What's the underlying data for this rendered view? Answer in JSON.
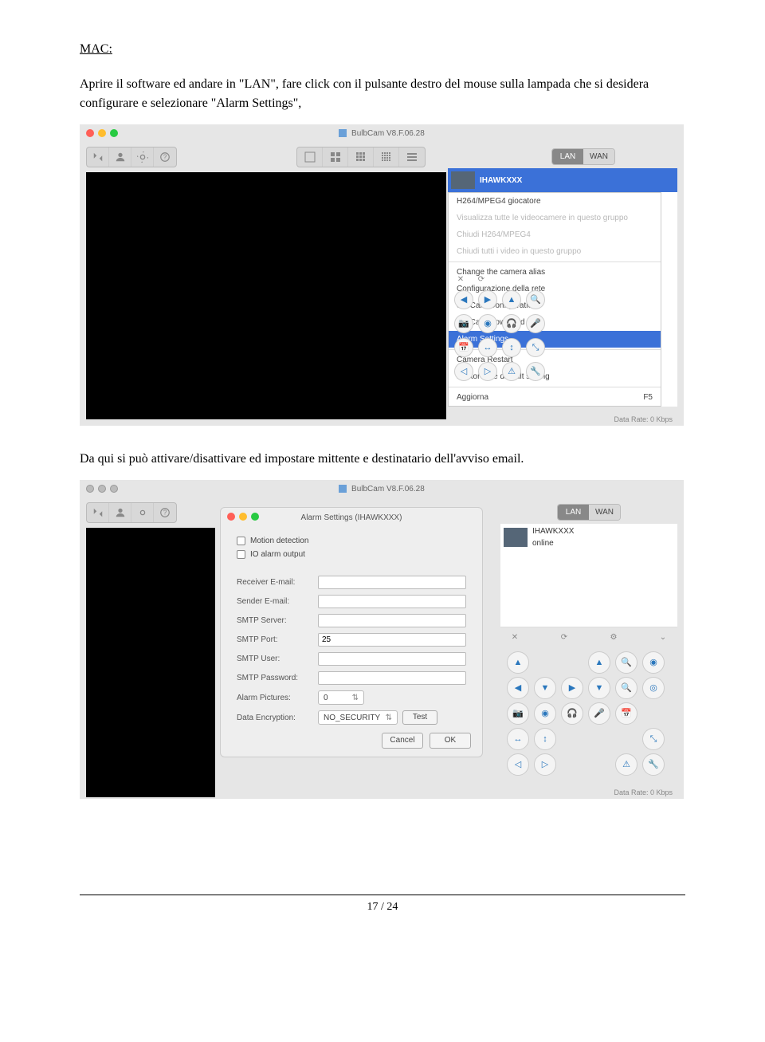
{
  "doc": {
    "heading": "MAC:",
    "para1": "Aprire il software ed andare in \"LAN\", fare click con il pulsante destro del mouse sulla lampada che si desidera configurare e selezionare \"Alarm Settings\",",
    "para2": "Da qui si può attivare/disattivare ed impostare mittente e destinatario dell'avviso email.",
    "page": "17 / 24"
  },
  "app": {
    "title": "BulbCam V8.F.06.28"
  },
  "tabs": {
    "lan": "LAN",
    "wan": "WAN"
  },
  "camera": {
    "name1": "IHAWKXXX",
    "status": "online"
  },
  "menu": {
    "0": "H264/MPEG4 giocatore",
    "1": "Visualizza tutte le videocamere in questo gruppo",
    "2": "Chiudi H264/MPEG4",
    "3": "Chiudi tutti i video in questo gruppo",
    "4": "Change the camera alias",
    "5": "Configurazione della rete",
    "6": "SD Card Configuration",
    "7": "SD Card Download",
    "8": "Alarm Settings",
    "9": "Camera Restart",
    "10": "Restore the default setting",
    "11": "Aggiorna",
    "shortcut": "F5"
  },
  "dialog": {
    "title": "Alarm Settings (IHAWKXXX)",
    "motion": "Motion detection",
    "ioalarm": "IO alarm output",
    "labels": {
      "receiver": "Receiver E-mail:",
      "sender": "Sender E-mail:",
      "smtpserver": "SMTP Server:",
      "smtpport": "SMTP Port:",
      "smtpuser": "SMTP User:",
      "smtppass": "SMTP Password:",
      "pictures": "Alarm Pictures:",
      "encryption": "Data Encryption:"
    },
    "values": {
      "port": "25",
      "pictures": "0",
      "encryption": "NO_SECURITY"
    },
    "test": "Test",
    "cancel": "Cancel",
    "ok": "OK"
  },
  "datarate": {
    "label1": "Data Rate: 0 Kbps",
    "label2": "Data Rate: 0 Kbps"
  }
}
